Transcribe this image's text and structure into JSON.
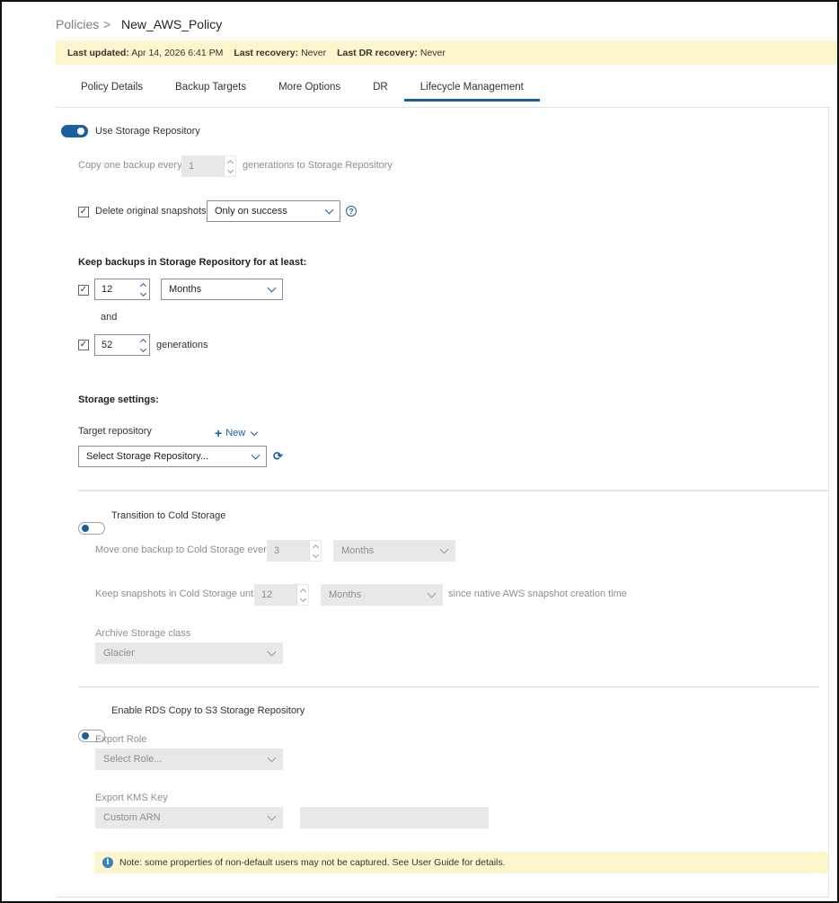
{
  "breadcrumb": {
    "root": "Policies",
    "separator": ">",
    "current": "New_AWS_Policy"
  },
  "info_bar": {
    "last_updated_label": "Last updated:",
    "last_updated_value": "Apr 14, 2026 6:41 PM",
    "last_recovery_label": "Last recovery:",
    "last_recovery_value": "Never",
    "last_dr_label": "Last DR recovery:",
    "last_dr_value": "Never"
  },
  "tabs": [
    {
      "label": "Policy Details",
      "active": false
    },
    {
      "label": "Backup Targets",
      "active": false
    },
    {
      "label": "More Options",
      "active": false
    },
    {
      "label": "DR",
      "active": false
    },
    {
      "label": "Lifecycle Management",
      "active": true
    }
  ],
  "storage_repo": {
    "toggle_label": "Use Storage Repository",
    "enabled": true,
    "copy_prefix": "Copy one backup every",
    "copy_value": "1",
    "copy_suffix": "generations to Storage Repository",
    "delete_label": "Delete original snapshots",
    "delete_checked": true,
    "delete_option": "Only on success",
    "keep_heading": "Keep backups in Storage Repository for at least:",
    "keep_period_value": "12",
    "keep_period_unit": "Months",
    "and_label": "and",
    "keep_gen_value": "52",
    "keep_gen_suffix": "generations",
    "storage_heading": "Storage settings:",
    "target_label": "Target repository",
    "new_label": "New",
    "target_placeholder": "Select Storage Repository..."
  },
  "cold_storage": {
    "toggle_label": "Transition to Cold Storage",
    "enabled": false,
    "move_prefix": "Move one backup to Cold Storage every",
    "move_value": "3",
    "move_unit": "Months",
    "keep_prefix": "Keep snapshots in Cold Storage until",
    "keep_value": "12",
    "keep_unit": "Months",
    "keep_suffix": "since native AWS snapshot creation time",
    "archive_label": "Archive Storage class",
    "archive_value": "Glacier"
  },
  "rds_copy": {
    "toggle_label": "Enable RDS Copy to S3 Storage Repository",
    "enabled": false,
    "role_label": "Export Role",
    "role_placeholder": "Select Role...",
    "kms_label": "Export KMS Key",
    "kms_value": "Custom ARN",
    "kms_arn_value": ""
  },
  "note": {
    "text": "Note: some properties of non-default users may not be captured. See User Guide for details."
  },
  "colors": {
    "accent": "#1a5fa0",
    "info_bg": "#fdf5cc",
    "disabled_bg": "#e8e8e8"
  }
}
